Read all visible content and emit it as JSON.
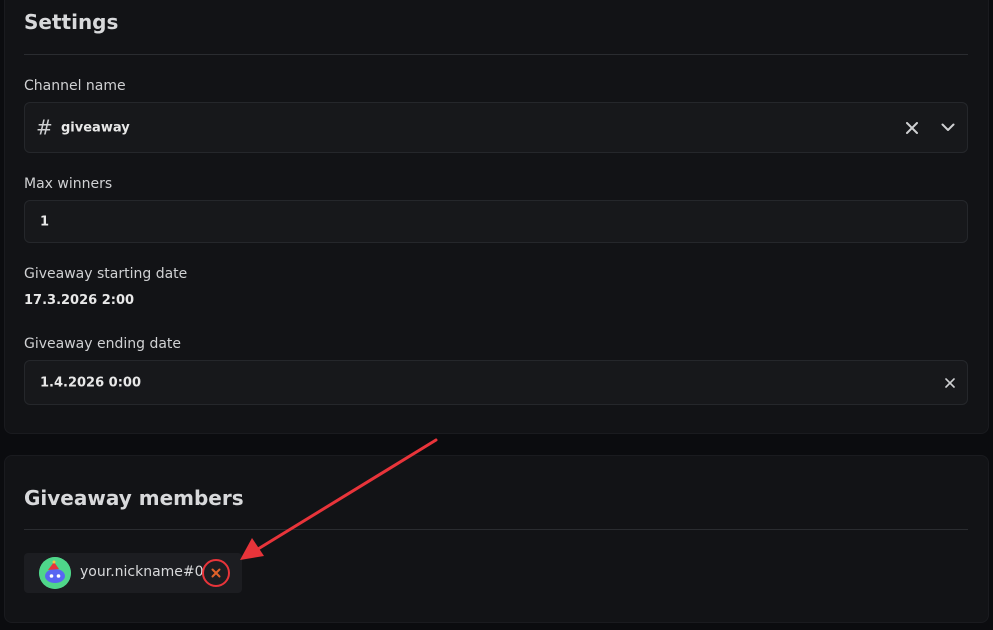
{
  "settings": {
    "title": "Settings",
    "channel": {
      "label": "Channel name",
      "value": "giveaway",
      "hash": "#"
    },
    "max_winners": {
      "label": "Max winners",
      "value": "1"
    },
    "start_date": {
      "label": "Giveaway starting date",
      "value": "17.3.2026 2:00"
    },
    "end_date": {
      "label": "Giveaway ending date",
      "value": "1.4.2026 0:00"
    }
  },
  "members": {
    "title": "Giveaway members",
    "items": [
      {
        "name": "your.nickname#0"
      }
    ]
  },
  "annotation": {
    "color": "#e8343a"
  }
}
